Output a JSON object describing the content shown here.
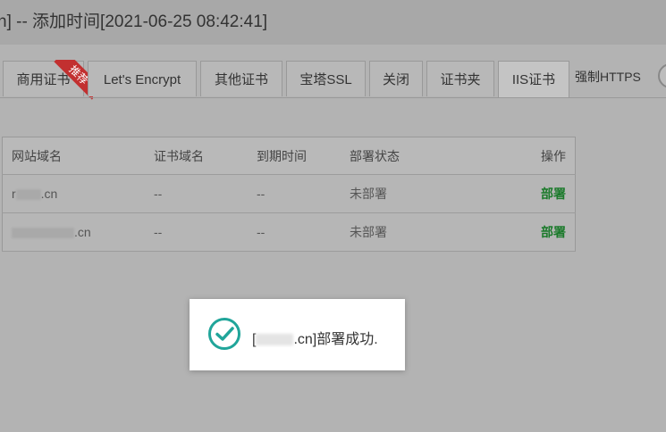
{
  "header": {
    "title": "n] -- 添加时间[2021-06-25 08:42:41]"
  },
  "tabs": [
    {
      "label": "商用证书",
      "ribbon": "推荐"
    },
    {
      "label": "Let's Encrypt"
    },
    {
      "label": "其他证书"
    },
    {
      "label": "宝塔SSL"
    },
    {
      "label": "关闭"
    },
    {
      "label": "证书夹"
    },
    {
      "label": "IIS证书",
      "active": true
    }
  ],
  "force_https": {
    "label": "强制HTTPS",
    "enabled": false
  },
  "table": {
    "columns": [
      "网站域名",
      "证书域名",
      "到期时间",
      "部署状态",
      "操作"
    ],
    "rows": [
      {
        "domain_prefix": "r",
        "domain_suffix": ".cn",
        "cert_domain": "--",
        "expire": "--",
        "status": "未部署",
        "action": "部署"
      },
      {
        "domain_prefix": "",
        "domain_suffix": ".cn",
        "cert_domain": "--",
        "expire": "--",
        "status": "未部署",
        "action": "部署"
      }
    ]
  },
  "toast": {
    "prefix": "[",
    "suffix": ".cn]部署成功.",
    "icon": "check-circle-icon",
    "icon_color": "#20a59a"
  },
  "colors": {
    "overlay_bg": "#b3b3b3",
    "deploy_link": "#1a7a2a",
    "ribbon": "#c23030"
  }
}
